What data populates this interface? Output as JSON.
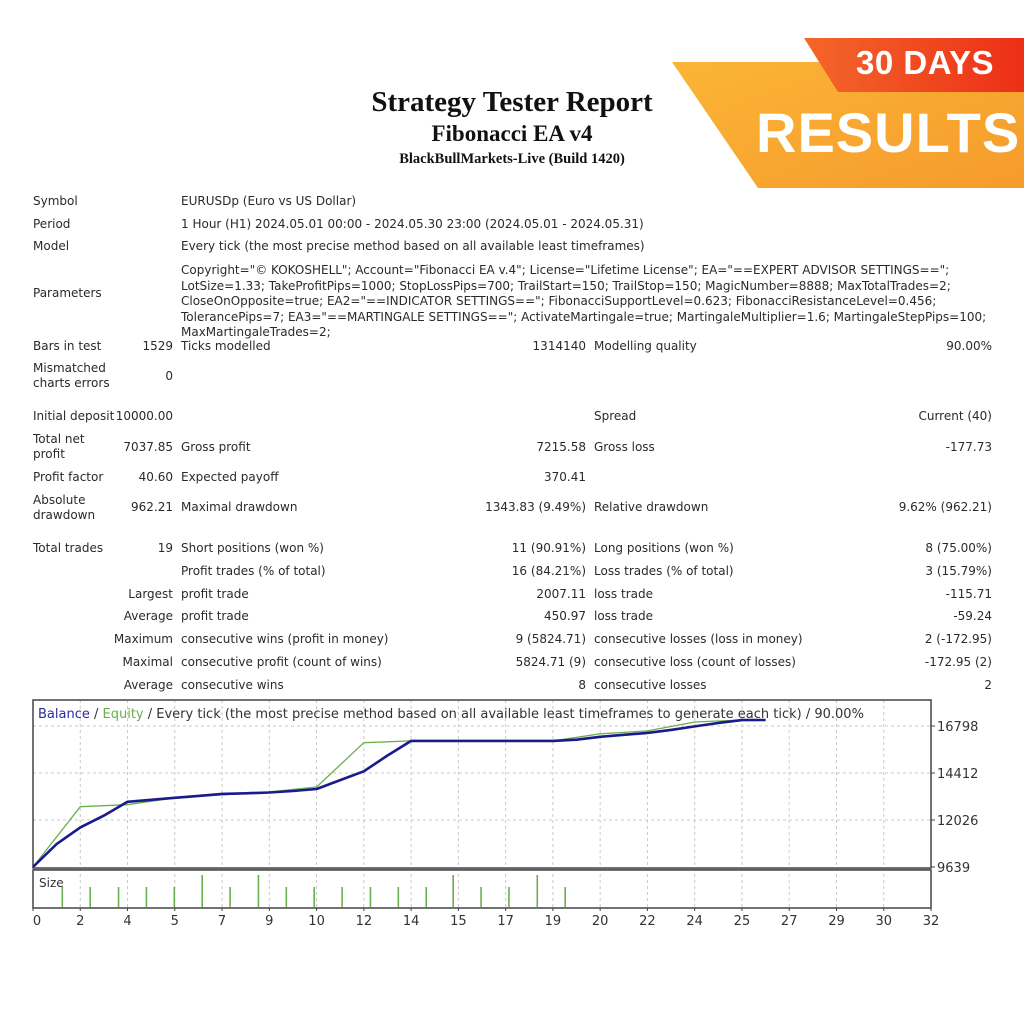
{
  "header": {
    "title": "Strategy Tester Report",
    "ea_name": "Fibonacci EA v4",
    "server": "BlackBullMarkets-Live (Build 1420)"
  },
  "banner": {
    "top_text": "30 DAYS",
    "main_text": "RESULTS",
    "colors": {
      "orange": "#f7a531",
      "red": "#ee3c1c"
    }
  },
  "info": {
    "symbol_label": "Symbol",
    "symbol_value": "EURUSDp (Euro vs US Dollar)",
    "period_label": "Period",
    "period_value": "1 Hour (H1) 2024.05.01 00:00 - 2024.05.30 23:00 (2024.05.01 - 2024.05.31)",
    "model_label": "Model",
    "model_value": "Every tick (the most precise method based on all available least timeframes)",
    "parameters_label": "Parameters",
    "parameters_value": "Copyright=\"© KOKOSHELL\"; Account=\"Fibonacci EA v.4\"; License=\"Lifetime License\"; EA=\"==EXPERT ADVISOR SETTINGS==\"; LotSize=1.33; TakeProfitPips=1000; StopLossPips=700; TrailStart=150; TrailStop=150; MagicNumber=8888; MaxTotalTrades=2; CloseOnOpposite=true; EA2=\"==INDICATOR SETTINGS==\"; FibonacciSupportLevel=0.623; FibonacciResistanceLevel=0.456; TolerancePips=7; EA3=\"==MARTINGALE SETTINGS==\"; ActivateMartingale=true; MartingaleMultiplier=1.6; MartingaleStepPips=100; MaxMartingaleTrades=2;"
  },
  "stats": {
    "bars_label": "Bars in test",
    "bars_value": "1529",
    "ticks_label": "Ticks modelled",
    "ticks_value": "1314140",
    "quality_label": "Modelling quality",
    "quality_value": "90.00%",
    "mismatch_label_1": "Mismatched",
    "mismatch_label_2": "charts errors",
    "mismatch_value": "0",
    "deposit_label": "Initial deposit",
    "deposit_value": "10000.00",
    "spread_label": "Spread",
    "spread_value": "Current (40)",
    "net_label_1": "Total net",
    "net_label_2": "profit",
    "net_value": "7037.85",
    "gross_profit_label": "Gross profit",
    "gross_profit_value": "7215.58",
    "gross_loss_label": "Gross loss",
    "gross_loss_value": "-177.73",
    "pf_label": "Profit factor",
    "pf_value": "40.60",
    "payoff_label": "Expected payoff",
    "payoff_value": "370.41",
    "abs_dd_label_1": "Absolute",
    "abs_dd_label_2": "drawdown",
    "abs_dd_value": "962.21",
    "max_dd_label": "Maximal drawdown",
    "max_dd_value": "1343.83 (9.49%)",
    "rel_dd_label": "Relative drawdown",
    "rel_dd_value": "9.62% (962.21)",
    "total_trades_label": "Total trades",
    "total_trades_value": "19",
    "short_label": "Short positions (won %)",
    "short_value": "11 (90.91%)",
    "long_label": "Long positions (won %)",
    "long_value": "8 (75.00%)",
    "profit_trades_label": "Profit trades (% of total)",
    "profit_trades_value": "16 (84.21%)",
    "loss_trades_label": "Loss trades (% of total)",
    "loss_trades_value": "3 (15.79%)",
    "largest_label": "Largest",
    "largest_profit_label": "profit trade",
    "largest_profit_value": "2007.11",
    "largest_loss_label": "loss trade",
    "largest_loss_value": "-115.71",
    "average_label": "Average",
    "average_profit_label": "profit trade",
    "average_profit_value": "450.97",
    "average_loss_label": "loss trade",
    "average_loss_value": "-59.24",
    "maximum_label": "Maximum",
    "max_cons_wins_label": "consecutive wins (profit in money)",
    "max_cons_wins_value": "9 (5824.71)",
    "max_cons_losses_label": "consecutive losses (loss in money)",
    "max_cons_losses_value": "2 (-172.95)",
    "maximal_label": "Maximal",
    "maximal_cons_profit_label": "consecutive profit (count of wins)",
    "maximal_cons_profit_value": "5824.71 (9)",
    "maximal_cons_loss_label": "consecutive loss (count of losses)",
    "maximal_cons_loss_value": "-172.95 (2)",
    "avg_label": "Average",
    "avg_cons_wins_label": "consecutive wins",
    "avg_cons_wins_value": "8",
    "avg_cons_losses_label": "consecutive losses",
    "avg_cons_losses_value": "2"
  },
  "chart_data": {
    "type": "line",
    "title_parts": {
      "balance": "Balance",
      "sep1": " / ",
      "equity": "Equity",
      "rest": " / Every tick (the most precise method based on all available least timeframes to generate each tick) / 90.00%"
    },
    "ylim": [
      9639,
      17300
    ],
    "y_ticks": [
      16798,
      14412,
      12026,
      9639
    ],
    "x_tick_labels": [
      "0",
      "2",
      "4",
      "5",
      "7",
      "9",
      "10",
      "12",
      "14",
      "15",
      "17",
      "19",
      "20",
      "22",
      "24",
      "25",
      "27",
      "29",
      "30",
      "32"
    ],
    "x_range": [
      0,
      19
    ],
    "grid": true,
    "series": [
      {
        "name": "Balance",
        "color": "#1a1a8c",
        "points": [
          [
            0,
            9639
          ],
          [
            0.5,
            10800
          ],
          [
            1,
            11650
          ],
          [
            1.5,
            12250
          ],
          [
            2,
            12950
          ],
          [
            2.5,
            13050
          ],
          [
            3,
            13150
          ],
          [
            3.5,
            13250
          ],
          [
            4,
            13350
          ],
          [
            4.5,
            13380
          ],
          [
            5,
            13420
          ],
          [
            5.5,
            13500
          ],
          [
            6,
            13600
          ],
          [
            6.5,
            14050
          ],
          [
            7,
            14500
          ],
          [
            7.5,
            15300
          ],
          [
            8,
            16040
          ],
          [
            8.5,
            16040
          ],
          [
            9,
            16040
          ],
          [
            10,
            16040
          ],
          [
            11,
            16040
          ],
          [
            11.5,
            16100
          ],
          [
            12,
            16250
          ],
          [
            12.5,
            16350
          ],
          [
            13,
            16450
          ],
          [
            13.5,
            16600
          ],
          [
            14,
            16780
          ],
          [
            14.5,
            16950
          ],
          [
            15,
            17100
          ],
          [
            15.5,
            17200
          ]
        ]
      },
      {
        "name": "Equity",
        "color": "#6ab04c",
        "points": [
          [
            0,
            9639
          ],
          [
            1,
            12700
          ],
          [
            2,
            12800
          ],
          [
            3,
            13150
          ],
          [
            4,
            13300
          ],
          [
            5,
            13450
          ],
          [
            6,
            13700
          ],
          [
            7,
            15950
          ],
          [
            8,
            16040
          ],
          [
            9,
            16040
          ],
          [
            10,
            16040
          ],
          [
            11,
            16040
          ],
          [
            12,
            16400
          ],
          [
            13,
            16550
          ],
          [
            14,
            17000
          ],
          [
            15,
            17200
          ],
          [
            15.5,
            17200
          ]
        ]
      }
    ],
    "size_panel": {
      "label": "Size",
      "color": "#6ab04c",
      "bars": [
        {
          "x": 0.62,
          "size": 1
        },
        {
          "x": 1.21,
          "size": 1
        },
        {
          "x": 1.81,
          "size": 1
        },
        {
          "x": 2.4,
          "size": 1
        },
        {
          "x": 2.99,
          "size": 1
        },
        {
          "x": 3.58,
          "size": 1.6
        },
        {
          "x": 4.17,
          "size": 1
        },
        {
          "x": 4.77,
          "size": 1.6
        },
        {
          "x": 5.36,
          "size": 1
        },
        {
          "x": 5.95,
          "size": 1
        },
        {
          "x": 6.54,
          "size": 1
        },
        {
          "x": 7.14,
          "size": 1
        },
        {
          "x": 7.73,
          "size": 1
        },
        {
          "x": 8.32,
          "size": 1
        },
        {
          "x": 8.89,
          "size": 1.6
        },
        {
          "x": 9.48,
          "size": 1
        },
        {
          "x": 10.07,
          "size": 1
        },
        {
          "x": 10.67,
          "size": 1.6
        },
        {
          "x": 11.26,
          "size": 1
        }
      ],
      "max_size": 1.7
    }
  }
}
